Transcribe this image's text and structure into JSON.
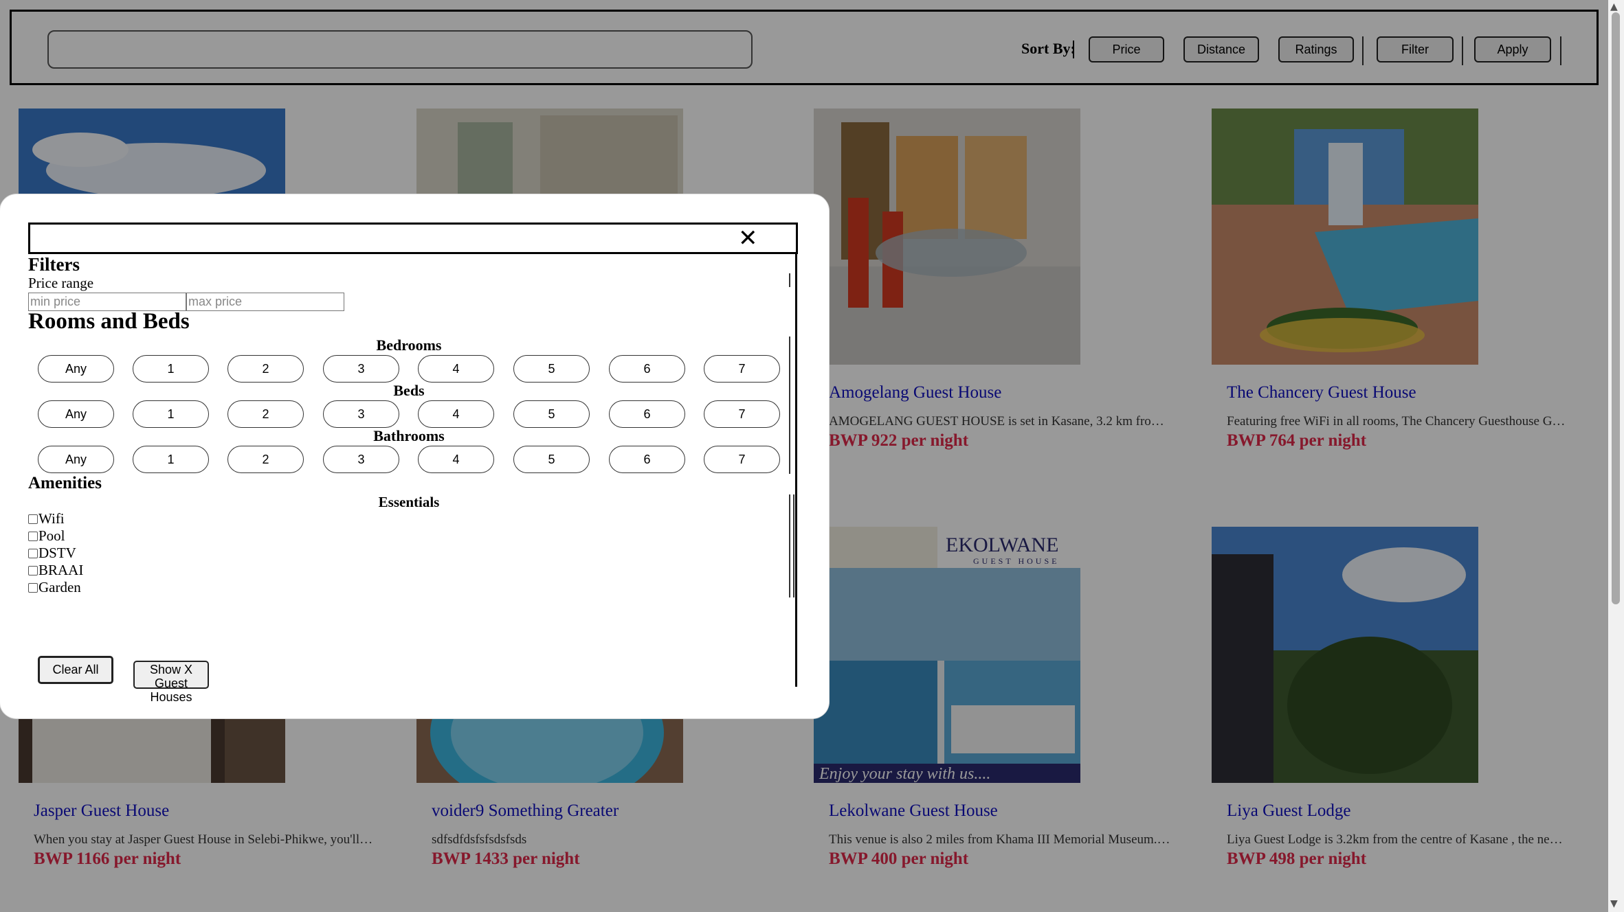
{
  "topbar": {
    "search_placeholder": "",
    "sort_label": "Sort By:",
    "buttons": {
      "price": "Price",
      "distance": "Distance",
      "ratings": "Ratings",
      "filter": "Filter",
      "apply": "Apply"
    }
  },
  "listings": [
    {
      "title": "Amogelang Guest House",
      "desc": "AMOGELANG GUEST HOUSE is set in Kasane, 3.2 km fro…",
      "price": "BWP 922 per night"
    },
    {
      "title": "The Chancery Guest House",
      "desc": "Featuring free WiFi in all rooms, The Chancery Guesthouse G…",
      "price": "BWP 764 per night"
    },
    {
      "title": "Jasper Guest House",
      "desc": "When you stay at Jasper Guest House in Selebi-Phikwe, you'll…",
      "price": "BWP 1166 per night"
    },
    {
      "title": "voider9 Something Greater",
      "desc": "sdfsdfdsfsfsdsfsds",
      "price": "BWP 1433 per night"
    },
    {
      "title": "Lekolwane Guest House",
      "desc": "This venue is also 2 miles from Khama III Memorial Museum.…",
      "price": "BWP 400 per night"
    },
    {
      "title": "Liya Guest Lodge",
      "desc": "Liya Guest Lodge is 3.2km from the centre of Kasane , the ne…",
      "price": "BWP 498 per night"
    }
  ],
  "lekolwane_sign": {
    "logo": "EKOLWANE",
    "subtitle": "GUEST HOUSE",
    "slogan": "Enjoy your stay with us...."
  },
  "modal": {
    "close_glyph": "✕",
    "filters_heading": "Filters",
    "price_range_label": "Price range",
    "min_price_placeholder": "min price",
    "max_price_placeholder": "max price",
    "rooms_heading": "Rooms and Beds",
    "bedrooms_label": "Bedrooms",
    "beds_label": "Beds",
    "bathrooms_label": "Bathrooms",
    "options": [
      "Any",
      "1",
      "2",
      "3",
      "4",
      "5",
      "6",
      "7"
    ],
    "amenities_heading": "Amenities",
    "essentials_label": "Essentials",
    "amenities": [
      "Wifi",
      "Pool",
      "DSTV",
      "BRAAI",
      "Garden"
    ],
    "clear_all": "Clear All",
    "show_lines": [
      "Show X",
      "Guest",
      "Houses"
    ]
  },
  "colors": {
    "title": "#1010c0",
    "price": "#e0284a",
    "overlay": "rgba(0,0,0,0.4)"
  },
  "icons": {
    "close": "close-icon",
    "scroll_up": "chevron-up-icon",
    "scroll_down": "chevron-down-icon"
  }
}
